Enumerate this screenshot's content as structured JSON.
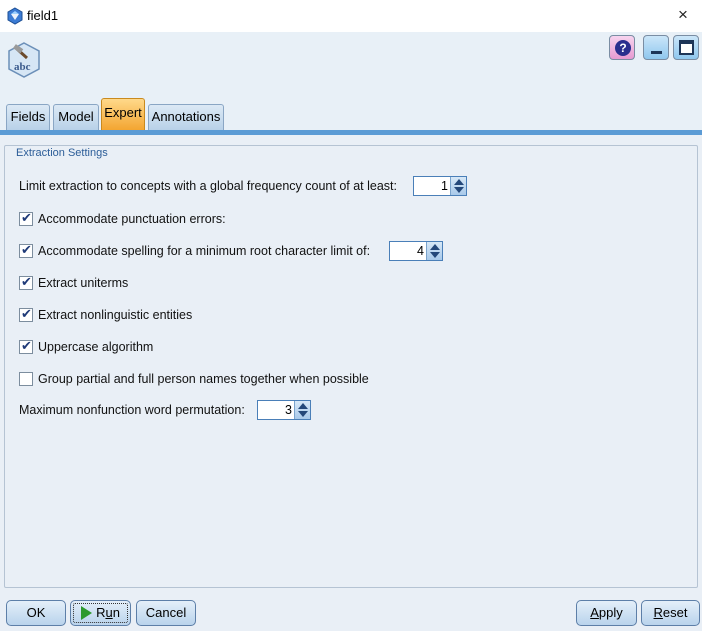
{
  "window": {
    "title": "field1",
    "close_glyph": "×"
  },
  "header": {
    "node_icon": "text-mining-node-icon",
    "help_glyph": "?",
    "help_icon": "help-icon",
    "minimize_icon": "minimize-icon",
    "maximize_icon": "maximize-icon"
  },
  "tabs": [
    {
      "label": "Fields",
      "active": false
    },
    {
      "label": "Model",
      "active": false
    },
    {
      "label": "Expert",
      "active": true
    },
    {
      "label": "Annotations",
      "active": false
    }
  ],
  "section": {
    "legend": "Extraction Settings"
  },
  "settings": {
    "frequency": {
      "label": "Limit extraction to concepts with a global frequency count of at least:",
      "value": "1"
    },
    "punctuation": {
      "label": "Accommodate punctuation errors:",
      "checked": true
    },
    "spelling": {
      "label": "Accommodate spelling for a minimum root character limit of:",
      "checked": true,
      "value": "4"
    },
    "uniterms": {
      "label": "Extract uniterms",
      "checked": true
    },
    "nonlinguistic": {
      "label": "Extract nonlinguistic entities",
      "checked": true
    },
    "uppercase": {
      "label": "Uppercase algorithm",
      "checked": true
    },
    "group_names": {
      "label": "Group partial and full person names together when possible",
      "checked": false
    },
    "permutation": {
      "label": "Maximum nonfunction word permutation:",
      "value": "3"
    }
  },
  "footer": {
    "ok": "OK",
    "run_prefix": "R",
    "run_underlined": "u",
    "run_suffix": "n",
    "cancel": "Cancel",
    "apply_underlined": "A",
    "apply_rest": "pply",
    "reset_underlined": "R",
    "reset_rest": "eset"
  },
  "colors": {
    "accent_blue": "#5b9bd5",
    "active_tab": "#f3a531",
    "content_bg": "#e9eff6",
    "run_green": "#2e9a2e"
  }
}
